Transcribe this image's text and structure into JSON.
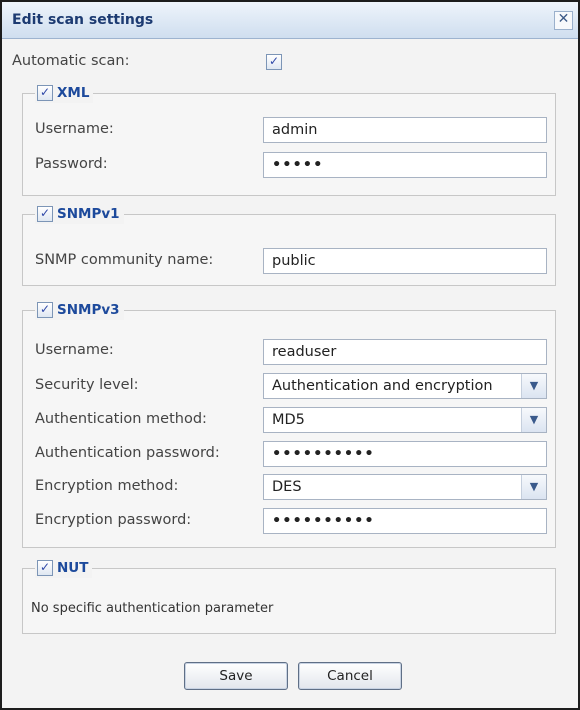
{
  "dialog": {
    "title": "Edit scan settings",
    "close_glyph": "✕"
  },
  "automatic_scan": {
    "label": "Automatic scan:",
    "checked": true
  },
  "check_glyph": "✓",
  "xml": {
    "title": "XML",
    "enabled": true,
    "username_label": "Username:",
    "username_value": "admin",
    "password_label": "Password:",
    "password_value": "•••••"
  },
  "snmpv1": {
    "title": "SNMPv1",
    "enabled": true,
    "community_label": "SNMP community name:",
    "community_value": "public"
  },
  "snmpv3": {
    "title": "SNMPv3",
    "enabled": true,
    "username_label": "Username:",
    "username_value": "readuser",
    "security_level_label": "Security level:",
    "security_level_value": "Authentication and encryption",
    "auth_method_label": "Authentication method:",
    "auth_method_value": "MD5",
    "auth_password_label": "Authentication password:",
    "auth_password_value": "••••••••••",
    "enc_method_label": "Encryption method:",
    "enc_method_value": "DES",
    "enc_password_label": "Encryption password:",
    "enc_password_value": "••••••••••"
  },
  "nut": {
    "title": "NUT",
    "enabled": true,
    "note": "No specific authentication parameter"
  },
  "footer": {
    "save_label": "Save",
    "cancel_label": "Cancel"
  },
  "icons": {
    "dropdown": "chevron-down-icon",
    "close": "close-icon",
    "check": "check-icon"
  },
  "colors": {
    "title_text": "#1d3b72",
    "legend_text": "#1d4a9c",
    "titlebar_top": "#eef4fb",
    "titlebar_bottom": "#cfdeef"
  }
}
